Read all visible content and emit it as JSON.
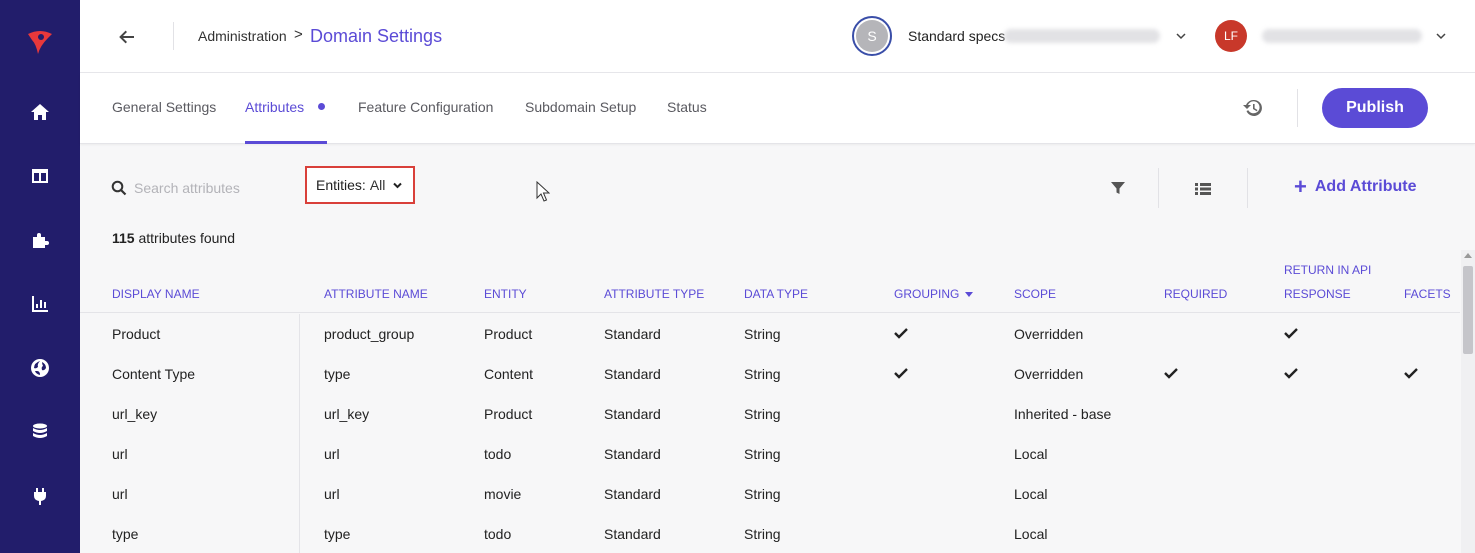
{
  "sidebar": {
    "items": [
      {
        "icon": "home-icon",
        "label": "Home"
      },
      {
        "icon": "layout-icon",
        "label": "Layout"
      },
      {
        "icon": "puzzle-icon",
        "label": "Extensions"
      },
      {
        "icon": "chart-icon",
        "label": "Analytics"
      },
      {
        "icon": "globe-icon",
        "label": "Domains"
      },
      {
        "icon": "database-icon",
        "label": "Data"
      },
      {
        "icon": "plug-icon",
        "label": "Integrations"
      }
    ]
  },
  "header": {
    "breadcrumb_admin": "Administration",
    "breadcrumb_sep": ">",
    "title": "Domain Settings",
    "spec_avatar_initial": "S",
    "spec_label": "Standard specs",
    "user_initials": "LF"
  },
  "tabs": {
    "items": [
      "General Settings",
      "Attributes",
      "Feature Configuration",
      "Subdomain Setup",
      "Status"
    ],
    "active": "Attributes",
    "publish_label": "Publish"
  },
  "toolbar": {
    "search_placeholder": "Search attributes",
    "entities_label": "Entities:",
    "entities_value": "All",
    "add_attribute_label": "Add Attribute"
  },
  "results": {
    "count": "115",
    "count_suffix": "attributes found"
  },
  "table": {
    "headers": {
      "display_name": "DISPLAY NAME",
      "attribute_name": "ATTRIBUTE NAME",
      "entity": "ENTITY",
      "attribute_type": "ATTRIBUTE TYPE",
      "data_type": "DATA TYPE",
      "grouping": "GROUPING",
      "scope": "SCOPE",
      "required": "REQUIRED",
      "return_api_line1": "RETURN IN API",
      "return_api_line2": "RESPONSE",
      "facets": "FACETS"
    },
    "rows": [
      {
        "display_name": "Product",
        "attribute_name": "product_group",
        "entity": "Product",
        "attribute_type": "Standard",
        "data_type": "String",
        "grouping": true,
        "scope": "Overridden",
        "required": false,
        "return_api": true,
        "facets": false
      },
      {
        "display_name": "Content Type",
        "attribute_name": "type",
        "entity": "Content",
        "attribute_type": "Standard",
        "data_type": "String",
        "grouping": true,
        "scope": "Overridden",
        "required": true,
        "return_api": true,
        "facets": true
      },
      {
        "display_name": "url_key",
        "attribute_name": "url_key",
        "entity": "Product",
        "attribute_type": "Standard",
        "data_type": "String",
        "grouping": false,
        "scope": "Inherited - base",
        "required": false,
        "return_api": false,
        "facets": false
      },
      {
        "display_name": "url",
        "attribute_name": "url",
        "entity": "todo",
        "attribute_type": "Standard",
        "data_type": "String",
        "grouping": false,
        "scope": "Local",
        "required": false,
        "return_api": false,
        "facets": false
      },
      {
        "display_name": "url",
        "attribute_name": "url",
        "entity": "movie",
        "attribute_type": "Standard",
        "data_type": "String",
        "grouping": false,
        "scope": "Local",
        "required": false,
        "return_api": false,
        "facets": false
      },
      {
        "display_name": "type",
        "attribute_name": "type",
        "entity": "todo",
        "attribute_type": "Standard",
        "data_type": "String",
        "grouping": false,
        "scope": "Local",
        "required": false,
        "return_api": false,
        "facets": false
      }
    ]
  },
  "colors": {
    "accent": "#5b4bd6",
    "sidebar": "#221d6b",
    "highlight_border": "#d9403a",
    "user_avatar": "#c8382a"
  }
}
